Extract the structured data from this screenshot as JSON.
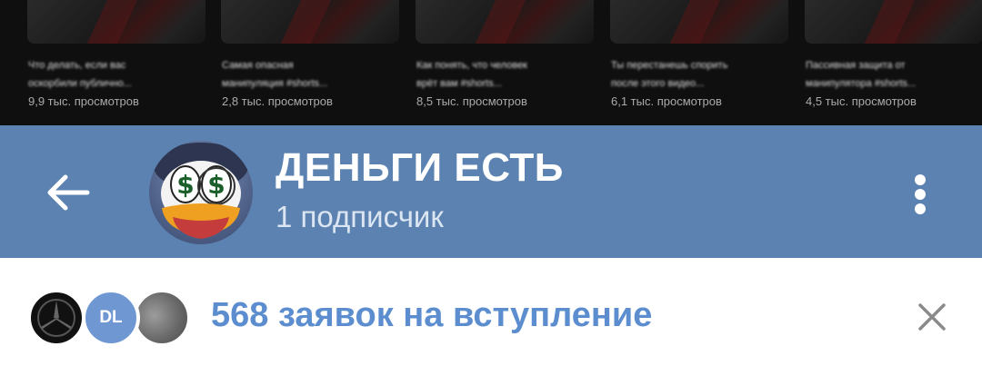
{
  "videos": [
    {
      "title": "Что делать, если вас\nоскорбили публично...",
      "views": "9,9 тыс. просмотров"
    },
    {
      "title": "Самая опасная\nманипуляция #shorts...",
      "views": "2,8 тыс. просмотров"
    },
    {
      "title": "Как понять, что человек\nврёт вам #shorts...",
      "views": "8,5 тыс. просмотров"
    },
    {
      "title": "Ты перестанешь спорить\nпосле этого видео...",
      "views": "6,1 тыс. просмотров"
    },
    {
      "title": "Пассивная защита от\nманипулятора #shorts...",
      "views": "4,5 тыс. просмотров"
    }
  ],
  "header": {
    "title": "ДЕНЬГИ ЕСТЬ",
    "subscribers": "1 подписчик",
    "back_icon": "arrow-left-icon",
    "menu_icon": "more-vertical-icon",
    "background": "#5b82b0"
  },
  "requests": {
    "text": "568 заявок на вступление",
    "avatars": [
      {
        "initials": ""
      },
      {
        "initials": "DL"
      },
      {
        "initials": ""
      }
    ],
    "close_icon": "close-icon",
    "accent": "#5b8dcf"
  }
}
